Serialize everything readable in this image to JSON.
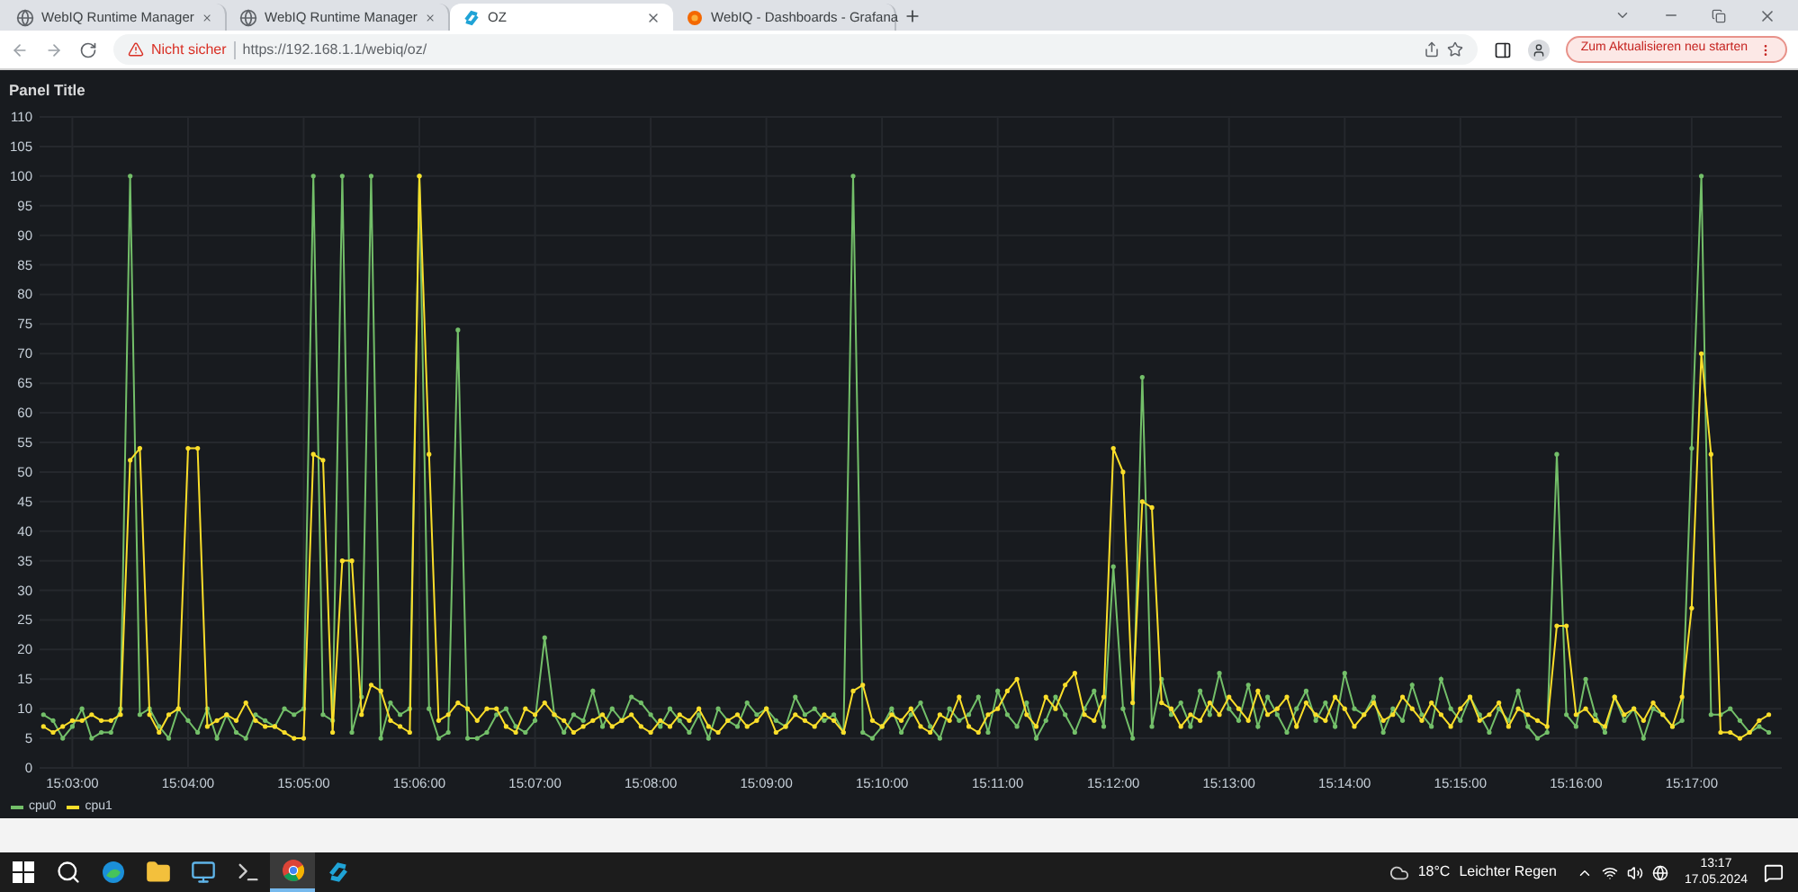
{
  "browser": {
    "tabs": [
      {
        "title": "WebIQ Runtime Manager",
        "kind": "globe",
        "selected": false
      },
      {
        "title": "WebIQ Runtime Manager",
        "kind": "globe",
        "selected": false
      },
      {
        "title": "OZ",
        "kind": "webiq",
        "selected": true
      },
      {
        "title": "WebIQ - Dashboards - Grafana",
        "kind": "grafana",
        "selected": false
      }
    ],
    "security_label": "Nicht sicher",
    "url": "https://192.168.1.1/webiq/oz/",
    "update_button": "Zum Aktualisieren neu starten"
  },
  "panel": {
    "title": "Panel Title",
    "chart_data": {
      "type": "line",
      "grid": true,
      "ylim": [
        0,
        110
      ],
      "yticks": [
        0,
        5,
        10,
        15,
        20,
        25,
        30,
        35,
        40,
        45,
        50,
        55,
        60,
        65,
        70,
        75,
        80,
        85,
        90,
        95,
        100,
        105,
        110
      ],
      "categories": [
        null,
        null,
        null,
        "15:03:00",
        null,
        null,
        null,
        null,
        null,
        null,
        null,
        null,
        null,
        null,
        null,
        "15:04:00",
        null,
        null,
        null,
        null,
        null,
        null,
        null,
        null,
        null,
        null,
        null,
        "15:05:00",
        null,
        null,
        null,
        null,
        null,
        null,
        null,
        null,
        null,
        null,
        null,
        "15:06:00",
        null,
        null,
        null,
        null,
        null,
        null,
        null,
        null,
        null,
        null,
        null,
        "15:07:00",
        null,
        null,
        null,
        null,
        null,
        null,
        null,
        null,
        null,
        null,
        null,
        "15:08:00",
        null,
        null,
        null,
        null,
        null,
        null,
        null,
        null,
        null,
        null,
        null,
        "15:09:00",
        null,
        null,
        null,
        null,
        null,
        null,
        null,
        null,
        null,
        null,
        null,
        "15:10:00",
        null,
        null,
        null,
        null,
        null,
        null,
        null,
        null,
        null,
        null,
        null,
        "15:11:00",
        null,
        null,
        null,
        null,
        null,
        null,
        null,
        null,
        null,
        null,
        null,
        "15:12:00",
        null,
        null,
        null,
        null,
        null,
        null,
        null,
        null,
        null,
        null,
        null,
        "15:13:00",
        null,
        null,
        null,
        null,
        null,
        null,
        null,
        null,
        null,
        null,
        null,
        "15:14:00",
        null,
        null,
        null,
        null,
        null,
        null,
        null,
        null,
        null,
        null,
        null,
        "15:15:00",
        null,
        null,
        null,
        null,
        null,
        null,
        null,
        null,
        null,
        null,
        null,
        "15:16:00",
        null,
        null,
        null,
        null,
        null,
        null,
        null,
        null,
        null,
        null,
        null,
        "15:17:00",
        null,
        null,
        null,
        null,
        null,
        null,
        null,
        null
      ],
      "series": [
        {
          "name": "cpu0",
          "color": "#73bf69",
          "values": [
            9,
            8,
            5,
            7,
            10,
            5,
            6,
            6,
            10,
            100,
            9,
            10,
            7,
            5,
            10,
            8,
            6,
            10,
            5,
            9,
            6,
            5,
            9,
            8,
            7,
            10,
            9,
            10,
            100,
            9,
            8,
            100,
            6,
            12,
            100,
            5,
            11,
            9,
            10,
            100,
            10,
            5,
            6,
            74,
            5,
            5,
            6,
            9,
            10,
            7,
            6,
            8,
            22,
            9,
            6,
            9,
            8,
            13,
            7,
            10,
            8,
            12,
            11,
            9,
            7,
            10,
            8,
            6,
            9,
            5,
            10,
            8,
            7,
            11,
            9,
            10,
            8,
            7,
            12,
            9,
            10,
            8,
            9,
            6,
            100,
            6,
            5,
            7,
            10,
            6,
            9,
            11,
            7,
            5,
            10,
            8,
            9,
            12,
            6,
            13,
            9,
            7,
            11,
            5,
            8,
            12,
            9,
            6,
            10,
            13,
            7,
            34,
            10,
            5,
            66,
            7,
            15,
            9,
            11,
            7,
            13,
            9,
            16,
            10,
            8,
            14,
            7,
            12,
            9,
            6,
            10,
            13,
            8,
            11,
            7,
            16,
            10,
            9,
            12,
            6,
            10,
            8,
            14,
            9,
            7,
            15,
            10,
            8,
            12,
            9,
            6,
            10,
            8,
            13,
            7,
            5,
            6,
            53,
            9,
            7,
            15,
            9,
            6,
            12,
            8,
            10,
            5,
            10,
            9,
            7,
            8,
            54,
            100,
            9,
            9,
            10,
            8,
            6,
            7,
            6
          ]
        },
        {
          "name": "cpu1",
          "color": "#fade2a",
          "values": [
            7,
            6,
            7,
            8,
            8,
            9,
            8,
            8,
            9,
            52,
            54,
            9,
            6,
            9,
            10,
            54,
            54,
            7,
            8,
            9,
            8,
            11,
            8,
            7,
            7,
            6,
            5,
            5,
            53,
            52,
            6,
            35,
            35,
            9,
            14,
            13,
            8,
            7,
            6,
            100,
            53,
            8,
            9,
            11,
            10,
            8,
            10,
            10,
            7,
            6,
            10,
            9,
            11,
            9,
            8,
            6,
            7,
            8,
            9,
            7,
            8,
            9,
            7,
            6,
            8,
            7,
            9,
            8,
            10,
            7,
            6,
            8,
            9,
            7,
            8,
            10,
            6,
            7,
            9,
            8,
            7,
            9,
            8,
            6,
            13,
            14,
            8,
            7,
            9,
            8,
            10,
            7,
            6,
            9,
            8,
            12,
            7,
            6,
            9,
            10,
            13,
            15,
            9,
            7,
            12,
            10,
            14,
            16,
            9,
            8,
            12,
            54,
            50,
            11,
            45,
            44,
            11,
            10,
            7,
            9,
            8,
            11,
            9,
            12,
            10,
            8,
            13,
            9,
            10,
            12,
            7,
            11,
            9,
            8,
            12,
            10,
            7,
            9,
            11,
            8,
            9,
            12,
            10,
            8,
            11,
            9,
            7,
            10,
            12,
            8,
            9,
            11,
            7,
            10,
            9,
            8,
            7,
            24,
            24,
            9,
            10,
            8,
            7,
            12,
            9,
            10,
            8,
            11,
            9,
            7,
            12,
            27,
            70,
            53,
            6,
            6,
            5,
            6,
            8,
            9
          ]
        }
      ]
    }
  },
  "taskbar": {
    "apps": [
      {
        "kind": "start",
        "selected": false
      },
      {
        "kind": "search",
        "selected": false
      },
      {
        "kind": "edge",
        "selected": false
      },
      {
        "kind": "explorer",
        "selected": false
      },
      {
        "kind": "remote",
        "selected": false
      },
      {
        "kind": "terminal",
        "selected": false
      },
      {
        "kind": "chrome",
        "selected": true
      },
      {
        "kind": "webiq",
        "selected": false
      }
    ],
    "weather": "18°C",
    "weather_text": "Leichter Regen",
    "time": "13:17",
    "date": "17.05.2024"
  }
}
